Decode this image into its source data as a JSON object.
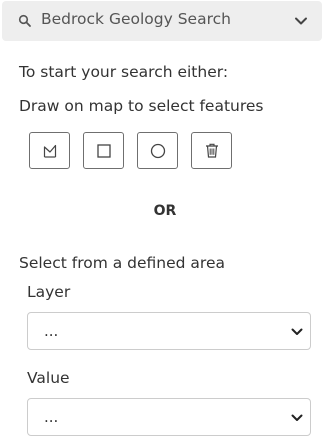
{
  "header": {
    "title": "Bedrock Geology Search",
    "search_icon": "search-icon",
    "toggle_icon": "chevron-down-icon"
  },
  "intro_text": "To start your search either:",
  "draw_text": "Draw on map to select features",
  "draw_tools": [
    {
      "name": "polygon",
      "icon": "polygon-icon"
    },
    {
      "name": "rectangle",
      "icon": "square-icon"
    },
    {
      "name": "circle",
      "icon": "circle-icon"
    },
    {
      "name": "delete",
      "icon": "trash-icon"
    }
  ],
  "or_text": "OR",
  "area_text": "Select from a defined area",
  "layer": {
    "label": "Layer",
    "selected": "..."
  },
  "value": {
    "label": "Value",
    "selected": "..."
  }
}
